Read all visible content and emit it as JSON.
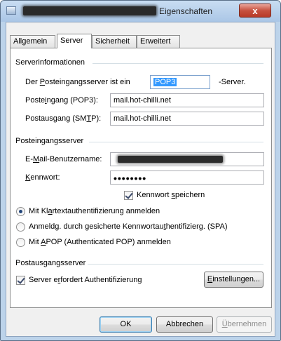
{
  "window": {
    "title_suffix": "Eigenschaften",
    "close_symbol": "x"
  },
  "tabs": [
    {
      "label": "Allgemein"
    },
    {
      "label": "Server"
    },
    {
      "label": "Sicherheit"
    },
    {
      "label": "Erweitert"
    }
  ],
  "server_info": {
    "group_label": "Serverinformationen",
    "incoming_type_prefix": "Der ",
    "incoming_type_accel": "P",
    "incoming_type_rest": "osteingangsserver ist ein",
    "incoming_type_value": "POP3",
    "incoming_type_suffix": "-Server.",
    "pop3_label_pre": "Poste",
    "pop3_label_accel": "i",
    "pop3_label_post": "ngang (POP3):",
    "pop3_value": "mail.hot-chilli.net",
    "smtp_label_pre": "Postausgang (SM",
    "smtp_label_accel": "T",
    "smtp_label_post": "P):",
    "smtp_value": "mail.hot-chilli.net"
  },
  "incoming_server": {
    "group_label": "Posteingangsserver",
    "username_label_pre": "E-",
    "username_label_accel": "M",
    "username_label_post": "ail-Benutzername:",
    "password_label_accel": "K",
    "password_label_post": "ennwort:",
    "password_value": "••••••••",
    "save_password_label_pre": "Kennwort ",
    "save_password_label_accel": "s",
    "save_password_label_post": "peichern",
    "auth_option_1_pre": "Mit Kl",
    "auth_option_1_accel": "a",
    "auth_option_1_post": "rtextauthentifizierung anmelden",
    "auth_option_2_pre": "Anmeldg. durch gesicherte Kennwortau",
    "auth_option_2_accel": "t",
    "auth_option_2_post": "hentifizierg. (SPA)",
    "auth_option_3_pre": "Mit ",
    "auth_option_3_accel": "A",
    "auth_option_3_post": "POP (Authenticated POP) anmelden"
  },
  "outgoing_server": {
    "group_label": "Postausgangsserver",
    "requires_auth_pre": "Server e",
    "requires_auth_accel": "r",
    "requires_auth_post": "fordert Authentifizierung",
    "settings_button_accel": "E",
    "settings_button_post": "instellungen..."
  },
  "footer": {
    "ok_label": "OK",
    "cancel_label": "Abbrechen",
    "apply_label_accel": "Ü",
    "apply_label_post": "bernehmen"
  },
  "colors": {
    "selection": "#3399ff",
    "close_button": "#c7513f"
  }
}
